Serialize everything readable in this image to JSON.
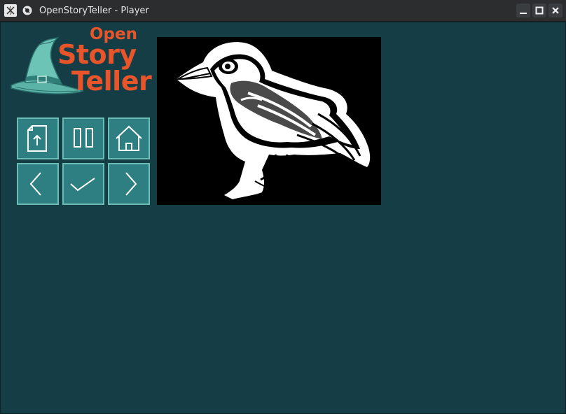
{
  "window": {
    "title": "OpenStoryTeller - Player"
  },
  "titlebar_icons": [
    "app-icon",
    "pin-icon",
    "minimize-icon",
    "maximize-icon",
    "close-icon"
  ],
  "logo": {
    "line1": "Open",
    "line2": "Story",
    "line3": "Teller"
  },
  "controls": [
    {
      "name": "load-story-button",
      "icon": "file-upload-icon"
    },
    {
      "name": "pause-button",
      "icon": "pause-icon"
    },
    {
      "name": "home-button",
      "icon": "home-icon"
    },
    {
      "name": "previous-button",
      "icon": "chevron-left-icon"
    },
    {
      "name": "ok-button",
      "icon": "checkmark-icon"
    },
    {
      "name": "next-button",
      "icon": "chevron-right-icon"
    }
  ],
  "story_image": {
    "subject": "bird-icon"
  },
  "colors": {
    "background": "#153d45",
    "button_fill": "#2d7f82",
    "button_border": "#6cbcb6",
    "logo_text": "#e8552a",
    "titlebar": "#2b2d2f"
  }
}
